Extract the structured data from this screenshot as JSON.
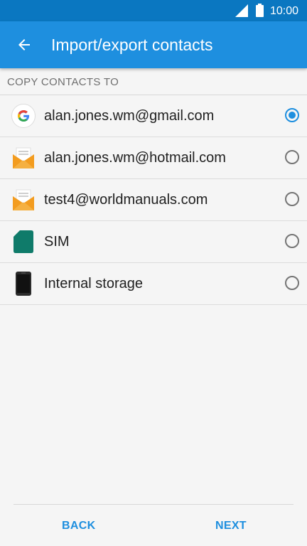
{
  "status_bar": {
    "time": "10:00",
    "icons": [
      "signal-icon",
      "battery-icon"
    ]
  },
  "app_bar": {
    "back_icon": "arrow-back-icon",
    "title": "Import/export contacts"
  },
  "section": {
    "header": "COPY CONTACTS TO"
  },
  "options": [
    {
      "label": "alan.jones.wm@gmail.com",
      "icon": "google-icon",
      "selected": true
    },
    {
      "label": "alan.jones.wm@hotmail.com",
      "icon": "email-icon",
      "selected": false
    },
    {
      "label": "test4@worldmanuals.com",
      "icon": "email-icon",
      "selected": false
    },
    {
      "label": "SIM",
      "icon": "sim-card-icon",
      "selected": false
    },
    {
      "label": "Internal storage",
      "icon": "phone-storage-icon",
      "selected": false
    }
  ],
  "footer": {
    "back_label": "BACK",
    "next_label": "NEXT"
  },
  "colors": {
    "status_bar": "#0a77c1",
    "app_bar": "#1e8fdf",
    "accent": "#1e8fdf",
    "background": "#f5f5f5"
  }
}
